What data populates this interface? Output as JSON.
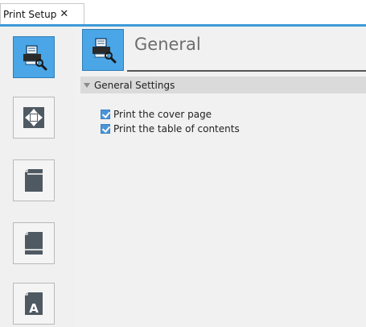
{
  "tab": {
    "label": "Print Setup",
    "close_glyph": "✕"
  },
  "sidebar": {
    "items": [
      {
        "name": "general",
        "icon": "printer-settings-icon",
        "active": true
      },
      {
        "name": "layout",
        "icon": "move-arrows-icon",
        "active": false
      },
      {
        "name": "header",
        "icon": "page-header-icon",
        "active": false
      },
      {
        "name": "footer",
        "icon": "page-footer-icon",
        "active": false
      },
      {
        "name": "font",
        "icon": "page-font-icon",
        "glyph": "A",
        "active": false
      }
    ]
  },
  "header": {
    "title": "General",
    "icon": "printer-settings-icon"
  },
  "section": {
    "title": "General Settings",
    "expanded": true
  },
  "options": [
    {
      "label": "Print the cover page",
      "checked": true
    },
    {
      "label": "Print the table of contents",
      "checked": true
    }
  ],
  "colors": {
    "accent": "#3d9ad8",
    "active_button": "#4aa6e6"
  }
}
